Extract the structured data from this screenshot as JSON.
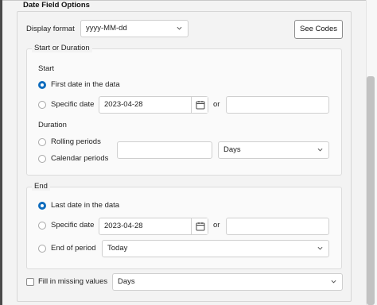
{
  "panel": {
    "title": "Date Field Options"
  },
  "display_format": {
    "label": "Display format",
    "value": "yyyy-MM-dd",
    "see_codes_label": "See Codes"
  },
  "start_or_duration": {
    "title": "Start or Duration",
    "start": {
      "heading": "Start",
      "first_date_label": "First date in the data",
      "specific_date_label": "Specific date",
      "specific_date_value": "2023-04-28",
      "or_label": "or",
      "alt_value": ""
    },
    "duration": {
      "heading": "Duration",
      "rolling_label": "Rolling periods",
      "calendar_label": "Calendar periods",
      "count_value": "",
      "unit_value": "Days"
    }
  },
  "end": {
    "title": "End",
    "last_date_label": "Last date in the data",
    "specific_date_label": "Specific date",
    "specific_date_value": "2023-04-28",
    "or_label": "or",
    "alt_value": "",
    "end_of_period_label": "End of period",
    "end_of_period_value": "Today"
  },
  "fill_missing": {
    "label": "Fill in missing values",
    "unit_value": "Days",
    "checked": false
  },
  "selections": {
    "start": "first_date",
    "end": "last_date"
  },
  "colors": {
    "accent": "#0f6cbd",
    "border": "#cfcfcf",
    "background": "#f3f3f3"
  }
}
